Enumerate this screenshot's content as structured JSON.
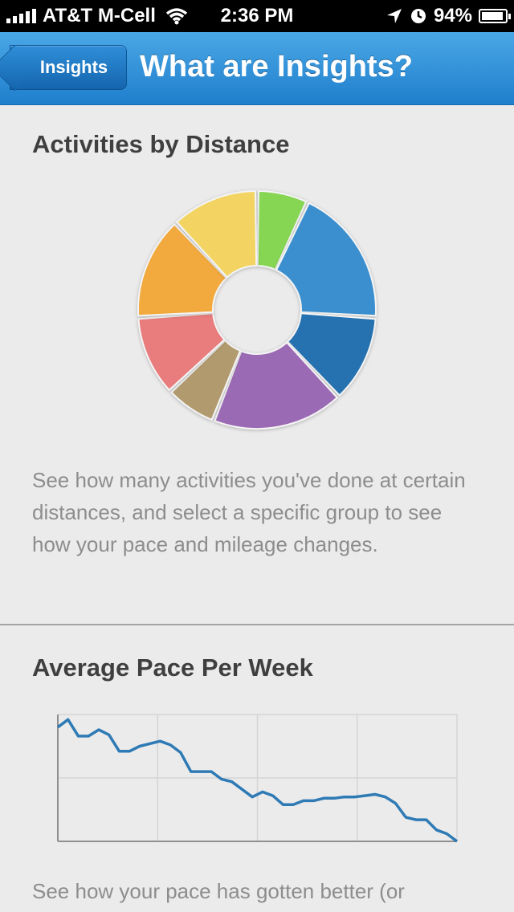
{
  "status_bar": {
    "carrier": "AT&T M-Cell",
    "time": "2:36 PM",
    "battery": "94%"
  },
  "nav": {
    "back_label": "Insights",
    "title": "What are Insights?"
  },
  "sections": [
    {
      "title": "Activities by Distance",
      "description": "See how many activities you've done at certain distances, and select a specific group to see how your pace and mileage changes."
    },
    {
      "title": "Average Pace Per Week",
      "description": "See how your pace has gotten better (or"
    }
  ],
  "chart_data": [
    {
      "type": "pie",
      "variant": "donut",
      "title": "Activities by Distance",
      "values": [
        7,
        19,
        12,
        18,
        7,
        11,
        14,
        12
      ],
      "colors": [
        "#86d553",
        "#3a8fcf",
        "#2672b0",
        "#9b6bb4",
        "#b19a6e",
        "#e97b7b",
        "#f2a93c",
        "#f3d463"
      ]
    },
    {
      "type": "line",
      "title": "Average Pace Per Week",
      "color": "#2e7ab5",
      "grid": true,
      "ylim": [
        0,
        1
      ],
      "x": [
        0,
        1,
        2,
        3,
        4,
        5,
        6,
        7,
        8,
        9,
        10,
        11,
        12,
        13,
        14,
        15,
        16,
        17,
        18,
        19,
        20,
        21,
        22,
        23,
        24,
        25,
        26,
        27,
        28,
        29,
        30,
        31,
        32,
        33,
        34,
        35,
        36,
        37,
        38,
        39
      ],
      "values": [
        0.9,
        0.96,
        0.83,
        0.83,
        0.88,
        0.84,
        0.71,
        0.71,
        0.75,
        0.77,
        0.79,
        0.76,
        0.7,
        0.55,
        0.55,
        0.55,
        0.49,
        0.47,
        0.41,
        0.35,
        0.39,
        0.36,
        0.29,
        0.29,
        0.32,
        0.32,
        0.34,
        0.34,
        0.35,
        0.35,
        0.36,
        0.37,
        0.35,
        0.3,
        0.19,
        0.17,
        0.17,
        0.09,
        0.06,
        0.0
      ]
    }
  ]
}
